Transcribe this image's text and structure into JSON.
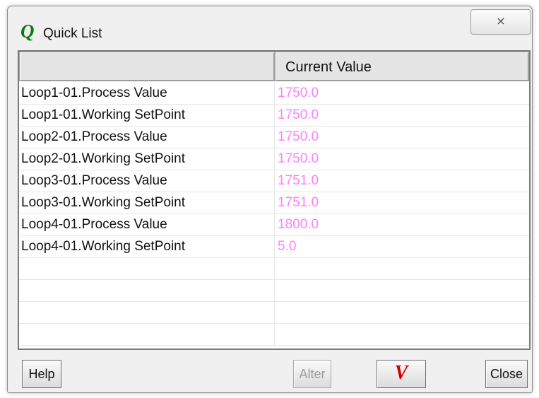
{
  "window": {
    "title": "Quick List",
    "app_icon_glyph": "Q",
    "app_icon_color": "#0a7a12",
    "close_glyph": "⨯"
  },
  "grid": {
    "headers": [
      "",
      "Current Value"
    ],
    "value_color": "#ff80ff",
    "rows": [
      {
        "name": "Loop1-01.Process Value",
        "value": "1750.0"
      },
      {
        "name": "Loop1-01.Working SetPoint",
        "value": "1750.0"
      },
      {
        "name": "Loop2-01.Process Value",
        "value": "1750.0"
      },
      {
        "name": "Loop2-01.Working SetPoint",
        "value": "1750.0"
      },
      {
        "name": "Loop3-01.Process Value",
        "value": "1751.0"
      },
      {
        "name": "Loop3-01.Working SetPoint",
        "value": "1751.0"
      },
      {
        "name": "Loop4-01.Process Value",
        "value": "1800.0"
      },
      {
        "name": "Loop4-01.Working SetPoint",
        "value": "5.0"
      },
      {
        "name": "",
        "value": ""
      },
      {
        "name": "",
        "value": ""
      },
      {
        "name": "",
        "value": ""
      },
      {
        "name": "",
        "value": ""
      }
    ]
  },
  "buttons": {
    "help": "Help",
    "alter": "Alter",
    "v_glyph": "V",
    "v_color": "#d10000",
    "close": "Close"
  }
}
